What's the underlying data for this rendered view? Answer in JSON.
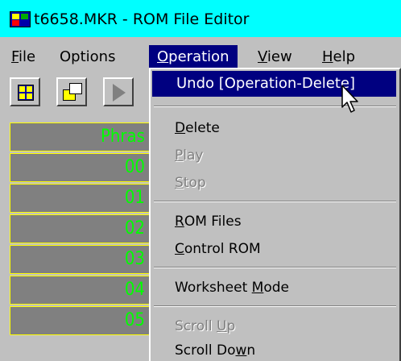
{
  "window": {
    "title": "t6658.MKR - ROM File Editor"
  },
  "menubar": [
    {
      "mnemonic": "F",
      "rest": "ile"
    },
    {
      "mnemonic": "",
      "rest": "Options"
    },
    {
      "mnemonic": "O",
      "rest": "peration"
    },
    {
      "mnemonic": "V",
      "rest": "iew"
    },
    {
      "mnemonic": "H",
      "rest": "elp"
    }
  ],
  "toolbar": {
    "icons": [
      "grid-icon",
      "restore-window-icon",
      "play-icon"
    ]
  },
  "grid": {
    "header": "Phras",
    "rows": [
      "00",
      "01",
      "02",
      "03",
      "04",
      "05"
    ]
  },
  "operation_menu": {
    "undo": "Undo [Operation-Delete]",
    "delete": {
      "mnemonic": "D",
      "rest": "elete"
    },
    "play": {
      "mnemonic": "P",
      "rest": "lay"
    },
    "stop": {
      "mnemonic": "S",
      "rest": "top"
    },
    "rom_files": {
      "mnemonic": "R",
      "rest": "OM Files"
    },
    "control_rom": {
      "mnemonic": "C",
      "rest": "ontrol ROM"
    },
    "worksheet_mode": {
      "before": "Worksheet ",
      "mnemonic": "M",
      "rest": "ode"
    },
    "scroll_up": {
      "before": "Scroll ",
      "mnemonic": "U",
      "rest": "p"
    },
    "scroll_down": {
      "before": "Scroll Do",
      "mnemonic": "w",
      "rest": "n"
    }
  },
  "colors": {
    "titlebar": "#00ffff",
    "menu_highlight": "#000080",
    "grid_text": "#00ff00",
    "grid_border": "#ffff00",
    "grid_cell": "#808080",
    "chrome": "#c0c0c0"
  }
}
